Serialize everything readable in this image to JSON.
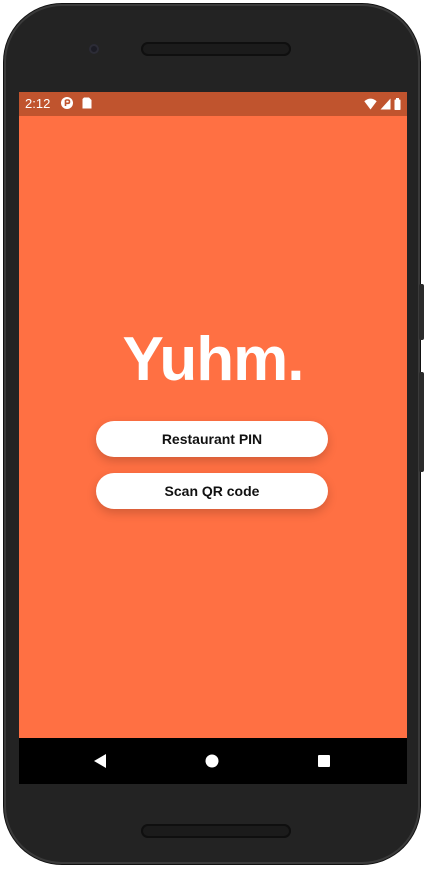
{
  "status_bar": {
    "time": "2:12",
    "left_icons": [
      "app-notification-icon",
      "sim-card-icon"
    ],
    "right_icons": [
      "wifi-icon",
      "cellular-signal-icon",
      "battery-icon"
    ],
    "background_color": "#c0542e"
  },
  "app": {
    "logo_text": "Yuhm.",
    "background_color": "#ff7043",
    "buttons": {
      "restaurant_pin_label": "Restaurant PIN",
      "scan_qr_label": "Scan QR code"
    }
  },
  "nav_bar": {
    "icons": [
      "back-icon",
      "home-icon",
      "recents-icon"
    ]
  }
}
